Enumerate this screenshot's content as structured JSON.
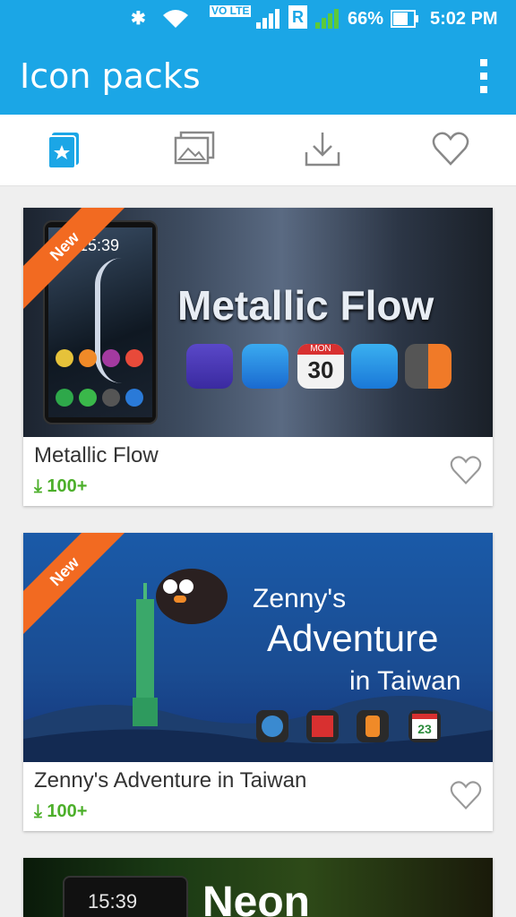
{
  "status_bar": {
    "battery": "66%",
    "time": "5:02 PM",
    "volte": "VO LTE",
    "roaming": "R"
  },
  "app_bar": {
    "title": "Icon packs"
  },
  "tabs": [
    {
      "icon": "icon-pack-icon",
      "active": true
    },
    {
      "icon": "wallpaper-icon",
      "active": false
    },
    {
      "icon": "download-icon",
      "active": false
    },
    {
      "icon": "heart-icon",
      "active": false
    }
  ],
  "cards": [
    {
      "title": "Metallic Flow",
      "downloads": "100+",
      "badge": "New",
      "banner_title": "Metallic Flow",
      "phone_time": "15:39",
      "calendar_month": "MON",
      "calendar_day": "30"
    },
    {
      "title": "Zenny's Adventure in Taiwan",
      "downloads": "100+",
      "badge": "New",
      "banner_line1": "Zenny's",
      "banner_line2": "Adventure",
      "banner_line3": "in Taiwan",
      "calendar_day": "23"
    },
    {
      "banner_title": "Neon",
      "phone_time": "15:39"
    }
  ],
  "colors": {
    "accent": "#1ba6e6",
    "ribbon": "#f26a21",
    "download_green": "#4caf2a"
  }
}
